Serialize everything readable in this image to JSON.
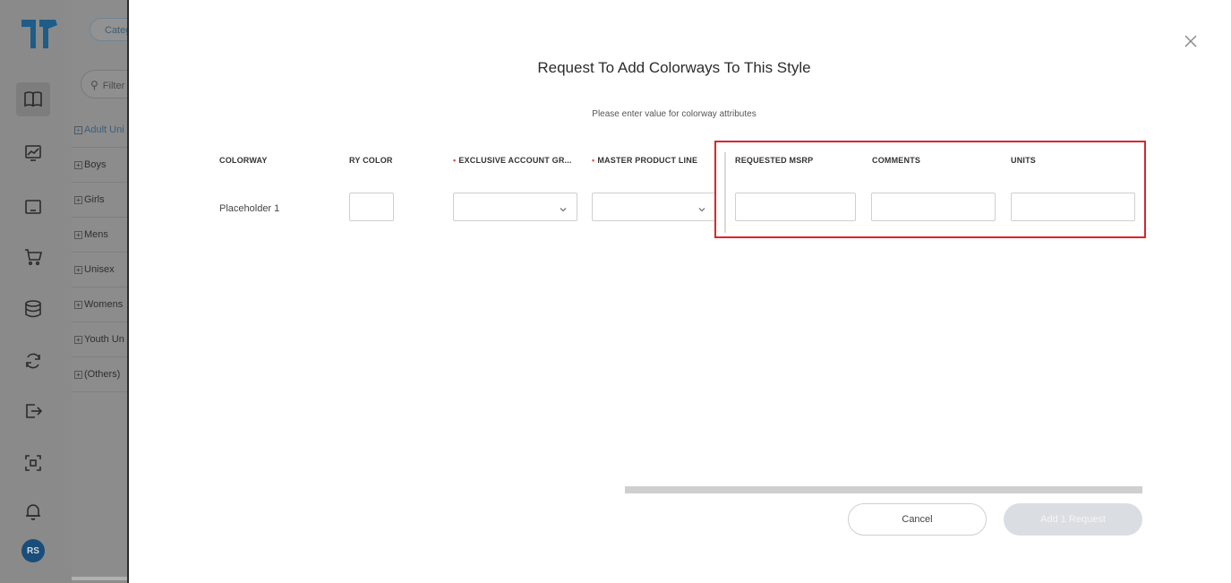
{
  "rail": {
    "logo": "tshirt-logo",
    "items": [
      {
        "icon": "book-icon",
        "active": true
      },
      {
        "icon": "chart-icon",
        "active": false
      },
      {
        "icon": "monitor-icon",
        "active": false
      },
      {
        "icon": "cart-icon",
        "active": false
      },
      {
        "icon": "database-icon",
        "active": false
      },
      {
        "icon": "sync-icon",
        "active": false
      },
      {
        "icon": "export-icon",
        "active": false
      },
      {
        "icon": "scan-icon",
        "active": false
      },
      {
        "icon": "bell-icon",
        "active": false
      }
    ],
    "avatar_initials": "RS"
  },
  "panel": {
    "category_button": "Categ",
    "filter_placeholder": "Filter",
    "tree": [
      "Adult Uni",
      "Boys",
      "Girls",
      "Mens",
      "Unisex",
      "Womens",
      "Youth Un",
      "(Others)"
    ]
  },
  "modal": {
    "title": "Request To Add Colorways To This Style",
    "subtitle": "Please enter value for colorway attributes",
    "columns": {
      "colorway": "COLORWAY",
      "primary_color": "RY COLOR",
      "exclusive_account": "EXCLUSIVE ACCOUNT GR...",
      "master_product_line": "MASTER PRODUCT LINE",
      "requested_msrp": "REQUESTED MSRP",
      "comments": "COMMENTS",
      "units": "UNITS"
    },
    "required_marker": "•",
    "row": {
      "colorway": "Placeholder 1",
      "primary_color": "",
      "exclusive_account": "",
      "master_product_line": "",
      "requested_msrp": "",
      "comments": "",
      "units": ""
    },
    "cancel_label": "Cancel",
    "submit_label": "Add 1 Request"
  },
  "colors": {
    "highlight": "#d9262b",
    "required": "#e04b4b",
    "brand": "#1f7ad1"
  }
}
